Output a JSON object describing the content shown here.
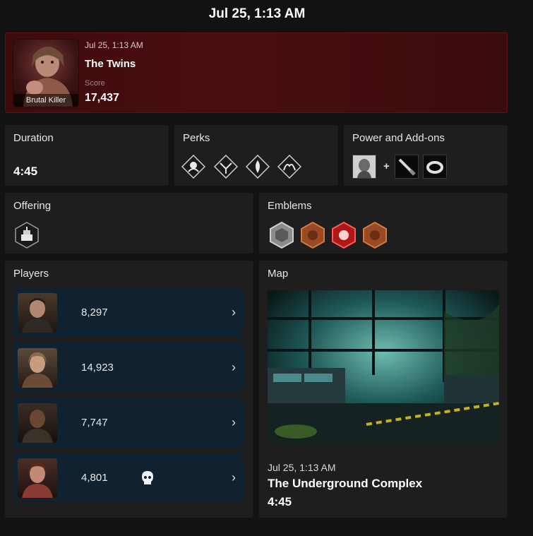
{
  "header": {
    "title": "Jul 25, 1:13 AM"
  },
  "match": {
    "date": "Jul 25, 1:13 AM",
    "killer_name": "The Twins",
    "portrait_caption": "Brutal Killer",
    "score_label": "Score",
    "score": "17,437",
    "accent_color": "#4a0e11"
  },
  "duration": {
    "title": "Duration",
    "value": "4:45"
  },
  "perks": {
    "title": "Perks",
    "items": [
      "perk-icon-1",
      "perk-icon-2",
      "perk-icon-3",
      "perk-icon-4"
    ]
  },
  "power": {
    "title": "Power and Add-ons",
    "power_icon": "twins-power-icon",
    "plus": "+",
    "addons": [
      "knife-addon-icon",
      "ring-addon-icon"
    ]
  },
  "offering": {
    "title": "Offering",
    "icon": "cake-offering-icon"
  },
  "emblems": {
    "title": "Emblems",
    "items": [
      {
        "name": "gatekeeper-emblem-icon",
        "tier": "silver"
      },
      {
        "name": "devout-emblem-icon",
        "tier": "bronze"
      },
      {
        "name": "malicious-emblem-icon",
        "tier": "iridescent"
      },
      {
        "name": "chaser-emblem-icon",
        "tier": "bronze"
      }
    ]
  },
  "players": {
    "title": "Players",
    "rows": [
      {
        "score": "8,297",
        "skull": false
      },
      {
        "score": "14,923",
        "skull": false
      },
      {
        "score": "7,747",
        "skull": false
      },
      {
        "score": "4,801",
        "skull": true
      }
    ],
    "chevron": "›"
  },
  "map": {
    "title": "Map",
    "date": "Jul 25, 1:13 AM",
    "name": "The Underground Complex",
    "duration": "4:45"
  }
}
